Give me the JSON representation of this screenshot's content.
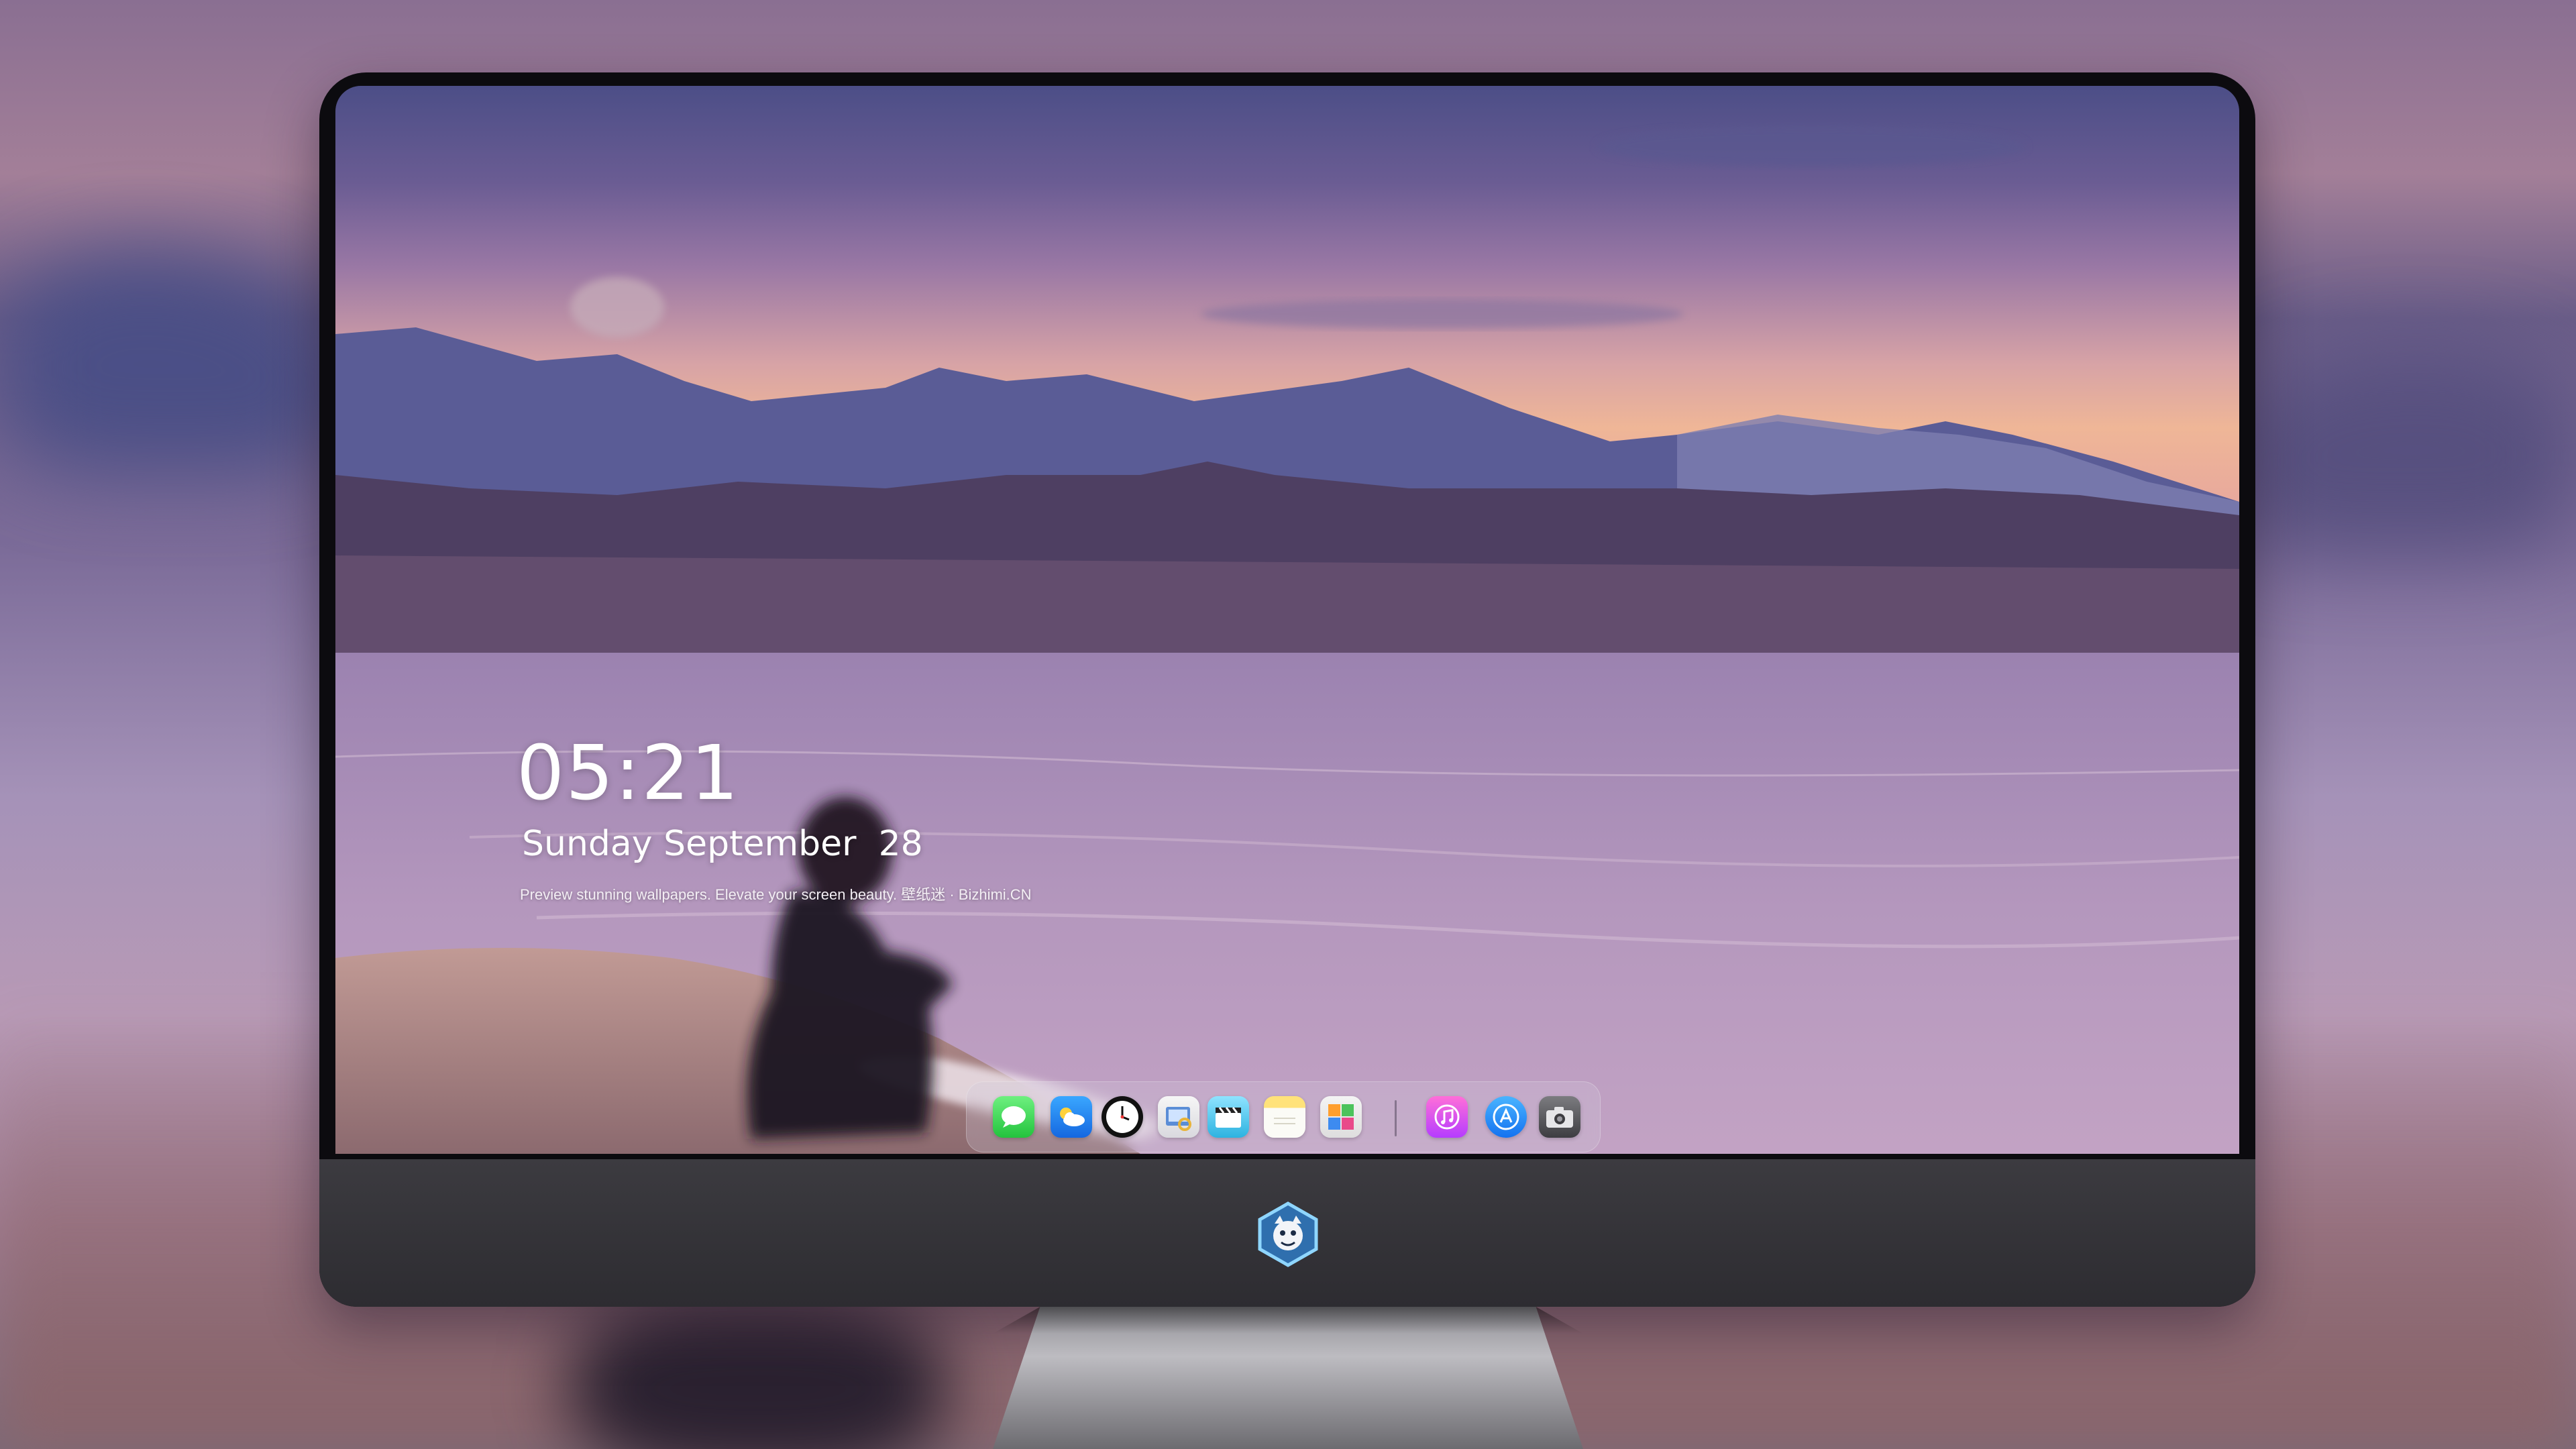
{
  "lock_screen": {
    "time": "05:21",
    "date": "Sunday September  28",
    "tagline": "Preview stunning wallpapers. Elevate your screen beauty. 壁纸迷 · Bizhimi.CN"
  },
  "dock": {
    "apps": [
      {
        "name": "messages-icon"
      },
      {
        "name": "weather-icon"
      },
      {
        "name": "clock-icon"
      },
      {
        "name": "preview-icon"
      },
      {
        "name": "clapperboard-icon"
      },
      {
        "name": "notes-icon"
      },
      {
        "name": "photos-icon"
      },
      {
        "name": "music-icon"
      },
      {
        "name": "app-store-icon"
      },
      {
        "name": "camera-icon"
      }
    ]
  },
  "colors": {
    "dock_background": "#d2c8dc",
    "bezel": "#0c0b0f",
    "chin": "#3c3b40"
  }
}
